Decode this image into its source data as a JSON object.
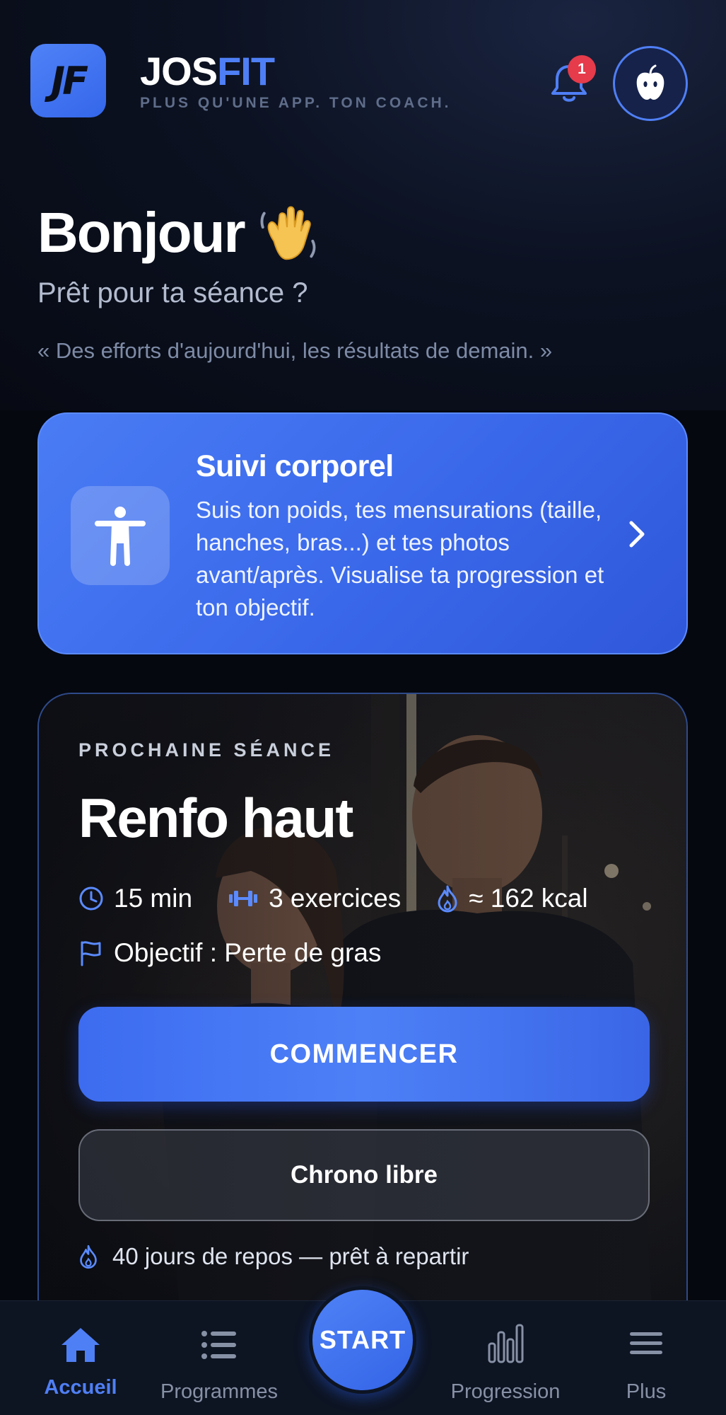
{
  "header": {
    "logo_text": "JF",
    "brand_part1": "JOS",
    "brand_part2": "FIT",
    "tagline": "PLUS QU'UNE APP. TON COACH.",
    "notification_count": "1"
  },
  "greeting": {
    "hello": "Bonjour",
    "ready": "Prêt pour ta séance ?",
    "quote": "« Des efforts d'aujourd'hui, les résultats de demain. »"
  },
  "body_tracking": {
    "title": "Suivi corporel",
    "description": "Suis ton poids, tes mensurations (taille, hanches, bras...) et tes photos avant/après. Visualise ta progression et ton objectif."
  },
  "next_session": {
    "label": "PROCHAINE SÉANCE",
    "title": "Renfo haut",
    "duration": "15 min",
    "exercises": "3 exercices",
    "calories": "≈ 162 kcal",
    "goal": "Objectif : Perte de gras",
    "start_label": "COMMENCER",
    "chrono_label": "Chrono libre",
    "rest_info": "40 jours de repos — prêt à repartir"
  },
  "nav": {
    "home": "Accueil",
    "programs": "Programmes",
    "fab": "START",
    "progress": "Progression",
    "more": "Plus"
  },
  "colors": {
    "accent": "#4f7ff5",
    "background": "#05080f",
    "badge": "#e53b4a"
  }
}
